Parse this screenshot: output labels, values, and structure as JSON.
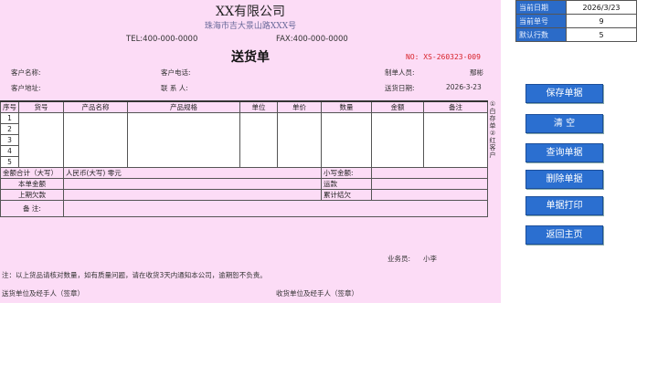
{
  "header": {
    "company": "XX有限公司",
    "address": "珠海市吉大景山路XXX号",
    "tel": "TEL:400-000-0000",
    "fax": "FAX:400-000-0000",
    "doc_title": "送货单",
    "doc_no": "NO: XS-260323-009"
  },
  "customer": {
    "name_label": "客户名称:",
    "phone_label": "客户电话:",
    "address_label": "客户地址:",
    "contact_label": "联 系 人:",
    "maker_label": "制单人员:",
    "maker_value": "鄢彬",
    "date_label": "送货日期:",
    "date_value": "2026-3-23"
  },
  "table": {
    "headers": [
      "序号",
      "货号",
      "产品名称",
      "产品规格",
      "单位",
      "单价",
      "数量",
      "金额",
      "备注"
    ],
    "rows": [
      "1",
      "2",
      "3",
      "4",
      "5"
    ]
  },
  "summary": {
    "total_upper_label": "金额合计（大写）",
    "currency_label": "人民币(大写)",
    "currency_value": "零元",
    "small_amount_label": "小写金额:",
    "current_amount_label": "本单金额",
    "freight_label": "运款",
    "last_owed_label": "上期欠款",
    "cum_owed_label": "累计结欠",
    "remark_label": "备    注:"
  },
  "side_note": "①白存单 ②红客户",
  "footer": {
    "salesman_label": "业务员:",
    "salesman_value": "小李",
    "note": "注：以上货品请核对数量，如有质量问题，请在收货3天内通知本公司，逾期恕不负责。",
    "sender_sign": "送货单位及经手人（签章）",
    "receiver_sign": "收货单位及经手人（签章）"
  },
  "info_panel": {
    "rows": [
      {
        "label": "当前日期",
        "value": "2026/3/23"
      },
      {
        "label": "当前单号",
        "value": "9"
      },
      {
        "label": "默认行数",
        "value": "5"
      }
    ]
  },
  "buttons": {
    "save": "保存单据",
    "clear": "清    空",
    "query": "查询单据",
    "delete": "删除单据",
    "print": "单据打印",
    "home": "返回主页"
  },
  "colors": {
    "sheet_bg": "#fcdcf6",
    "button_bg": "#2b6fd0",
    "label_bg": "#2b6bc8",
    "doc_no": "#d8222a"
  }
}
